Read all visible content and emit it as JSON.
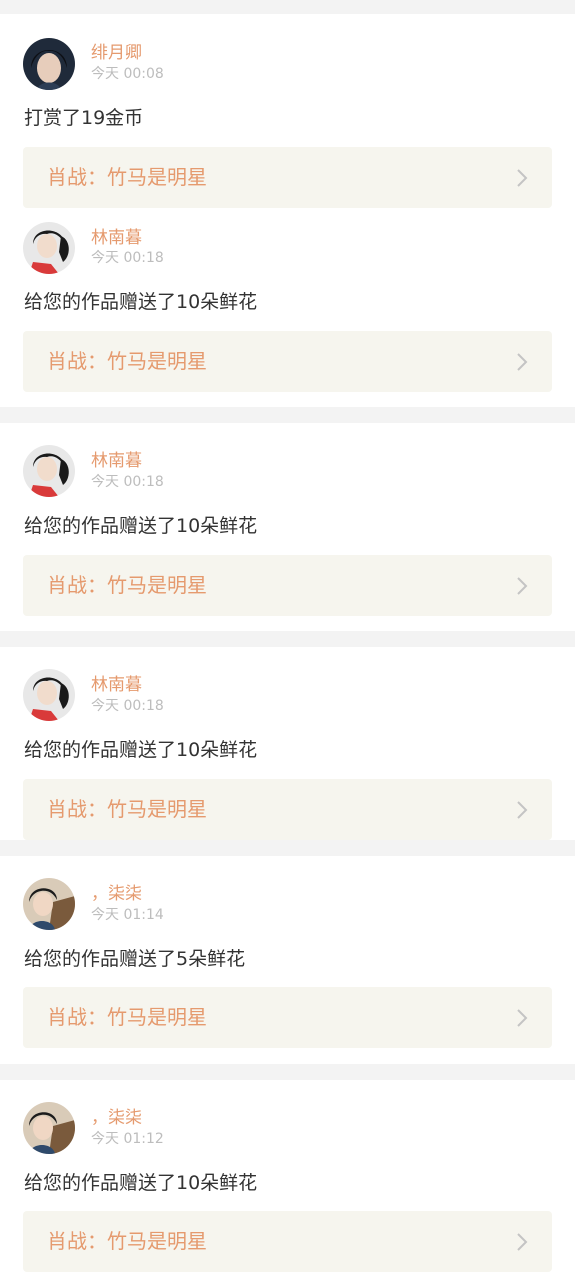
{
  "items": [
    {
      "user": "绯月卿",
      "time": "今天 00:08",
      "message": "打赏了19金币",
      "work": "肖战：竹马是明星",
      "avatar_icon": "avatar-dark-hair-icon"
    },
    {
      "user": "林南暮",
      "time": "今天 00:18",
      "message": "给您的作品赠送了10朵鲜花",
      "work": "肖战：竹马是明星",
      "avatar_icon": "avatar-girl-red-icon"
    },
    {
      "user": "林南暮",
      "time": "今天 00:18",
      "message": "给您的作品赠送了10朵鲜花",
      "work": "肖战：竹马是明星",
      "avatar_icon": "avatar-girl-red-icon"
    },
    {
      "user": "林南暮",
      "time": "今天 00:18",
      "message": "给您的作品赠送了10朵鲜花",
      "work": "肖战：竹马是明星",
      "avatar_icon": "avatar-girl-red-icon"
    },
    {
      "user": "，柒柒",
      "time": "今天 01:14",
      "message": "给您的作品赠送了5朵鲜花",
      "work": "肖战：竹马是明星",
      "avatar_icon": "avatar-boy-icon"
    },
    {
      "user": "，柒柒",
      "time": "今天 01:12",
      "message": "给您的作品赠送了10朵鲜花",
      "work": "肖战：竹马是明星",
      "avatar_icon": "avatar-boy-icon"
    }
  ],
  "colors": {
    "background": "#f3f3f3",
    "card": "#ffffff",
    "username": "#e59a6e",
    "timestamp": "#bdbdbd",
    "message": "#333333",
    "work_bg": "#f6f5ee",
    "work_title": "#e59a6e",
    "chevron": "#c4c4c4"
  }
}
